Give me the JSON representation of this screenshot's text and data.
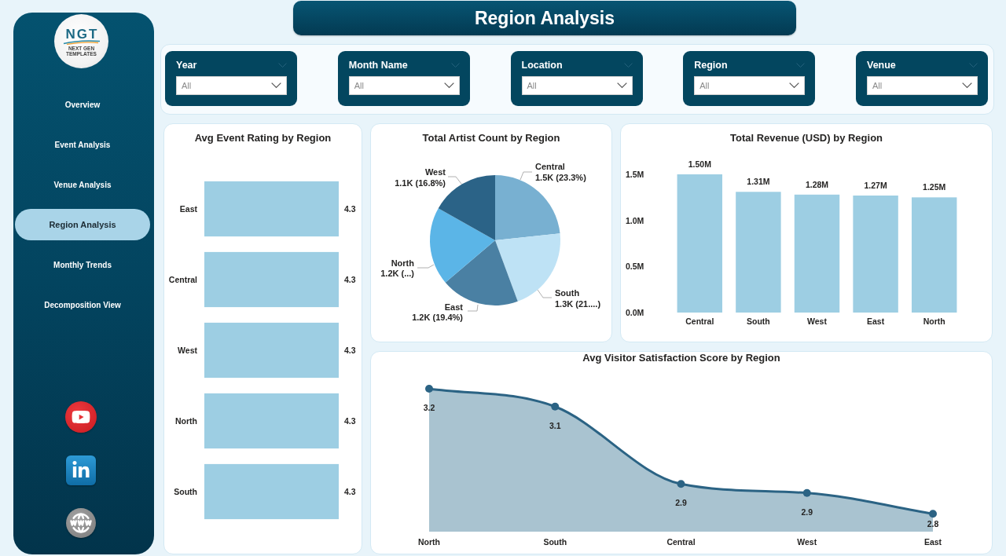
{
  "sidebar": {
    "logo": {
      "text": "NGT",
      "tagline": "NEXT GEN TEMPLATES"
    },
    "nav": [
      {
        "label": "Overview",
        "selected": false
      },
      {
        "label": "Event Analysis",
        "selected": false
      },
      {
        "label": "Venue Analysis",
        "selected": false
      },
      {
        "label": "Region Analysis",
        "selected": true
      },
      {
        "label": "Monthly Trends",
        "selected": false
      },
      {
        "label": "Decomposition View",
        "selected": false
      }
    ],
    "social_links": [
      {
        "kind": "youtube"
      },
      {
        "kind": "linkedin"
      },
      {
        "kind": "web"
      }
    ]
  },
  "header": {
    "title": "Region Analysis"
  },
  "filters": [
    {
      "label": "Year",
      "value": "All"
    },
    {
      "label": "Month Name",
      "value": "All"
    },
    {
      "label": "Location",
      "value": "All"
    },
    {
      "label": "Region",
      "value": "All"
    },
    {
      "label": "Venue",
      "value": "All"
    }
  ],
  "rating_chart": {
    "chart_data": {
      "type": "bar",
      "orientation": "horizontal",
      "title": "Avg Event Rating by Region",
      "categories": [
        "East",
        "Central",
        "West",
        "North",
        "South"
      ],
      "values": [
        4.3,
        4.3,
        4.3,
        4.3,
        4.3
      ],
      "data_labels": true
    }
  },
  "artist_chart": {
    "chart_data": {
      "type": "pie",
      "title": "Total Artist Count by Region",
      "categories": [
        "Central",
        "South",
        "East",
        "North",
        "West"
      ],
      "values": [
        1490,
        1345,
        1242,
        1238,
        1075
      ],
      "value_labels": [
        "1.5K (23.3%)",
        "1.3K (21....)",
        "1.2K (19.4%)",
        "1.2K (...)",
        "1.1K (16.8%)"
      ]
    }
  },
  "revenue_chart": {
    "chart_data": {
      "type": "bar",
      "orientation": "vertical",
      "title": "Total Revenue (USD) by Region",
      "categories": [
        "Central",
        "South",
        "West",
        "East",
        "North"
      ],
      "values": [
        1.5,
        1.31,
        1.28,
        1.27,
        1.25
      ],
      "ylim": [
        0,
        1.5
      ],
      "yticks": [
        {
          "value": 0,
          "label": "0.0M"
        },
        {
          "value": 0.5,
          "label": "0.5M"
        },
        {
          "value": 1,
          "label": "1.0M"
        },
        {
          "value": 1.5,
          "label": "1.5M"
        }
      ],
      "value_labels": [
        "1.50M",
        "1.31M",
        "1.28M",
        "1.27M",
        "1.25M"
      ]
    }
  },
  "satisfaction_chart": {
    "chart_data": {
      "type": "area",
      "title": "Avg Visitor Satisfaction Score by Region",
      "categories": [
        "North",
        "South",
        "Central",
        "West",
        "East"
      ],
      "values": [
        3.2,
        3.14,
        2.88,
        2.85,
        2.78
      ],
      "value_labels": [
        "3.2",
        "3.1",
        "2.9",
        "2.9",
        "2.8"
      ]
    }
  }
}
